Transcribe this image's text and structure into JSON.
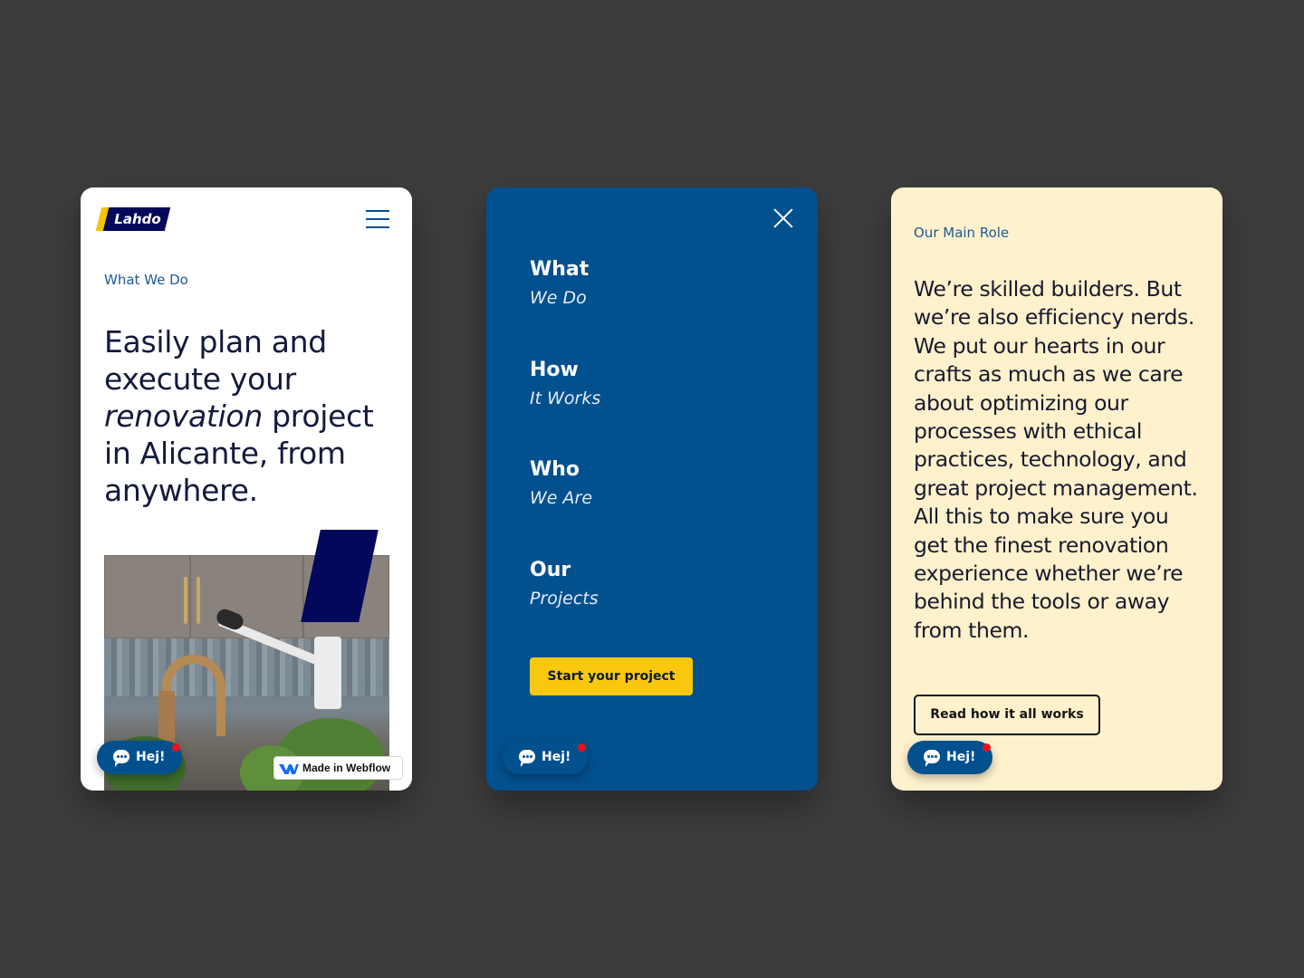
{
  "colors": {
    "background": "#3d3d3d",
    "primary_blue": "#03508f",
    "navy": "#04085a",
    "yellow": "#f9c80e",
    "cream": "#fff1cc",
    "notification_red": "#e8141b"
  },
  "card_home": {
    "logo_text": "Lahdo",
    "menu_icon": "hamburger-icon",
    "eyebrow": "What We Do",
    "headline": {
      "part1": "Easily plan and execute your ",
      "emphasis": "renovation",
      "part2": " project in Alicante, from anywhere."
    },
    "chat_label": "Hej!",
    "chat_icon": "chat-bubble-icon",
    "webflow_badge": "Made in Webflow",
    "webflow_icon": "webflow-logo-icon"
  },
  "card_menu": {
    "close_icon": "close-icon",
    "nav": [
      {
        "main": "What",
        "sub": "We Do"
      },
      {
        "main": "How",
        "sub": "It Works"
      },
      {
        "main": "Who",
        "sub": "We Are"
      },
      {
        "main": "Our",
        "sub": "Projects"
      }
    ],
    "cta_label": "Start your project",
    "chat_label": "Hej!"
  },
  "card_role": {
    "eyebrow": "Our Main Role",
    "body": "We’re skilled builders. But we’re also efficiency nerds. We put our hearts in our crafts as much as we care about optimizing our processes with ethical practices, technology, and great project management. All this to make sure you get the finest renovation experience whether we’re behind the tools or away from them.",
    "button_label": "Read how it all works",
    "chat_label": "Hej!"
  }
}
